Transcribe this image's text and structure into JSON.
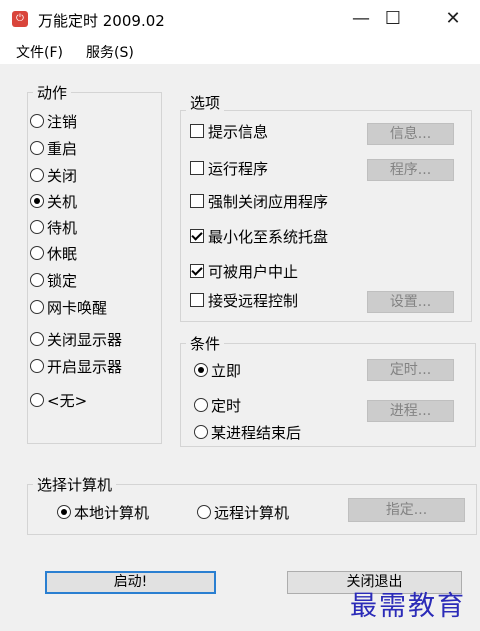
{
  "window": {
    "title": "万能定时 2009.02",
    "icon": "timer-app-icon"
  },
  "menu": [
    "文件(F)",
    "服务(S)"
  ],
  "actions": {
    "legend": "动作",
    "items": [
      {
        "label": "注销",
        "selected": false
      },
      {
        "label": "重启",
        "selected": false
      },
      {
        "label": "关闭",
        "selected": false
      },
      {
        "label": "关机",
        "selected": true
      },
      {
        "label": "待机",
        "selected": false
      },
      {
        "label": "休眠",
        "selected": false
      },
      {
        "label": "锁定",
        "selected": false
      },
      {
        "label": "网卡唤醒",
        "selected": false
      },
      {
        "label": "关闭显示器",
        "selected": false
      },
      {
        "label": "开启显示器",
        "selected": false
      },
      {
        "label": "<无>",
        "selected": false
      }
    ]
  },
  "options": {
    "legend": "选项",
    "items": [
      {
        "label": "提示信息",
        "checked": false,
        "button": "信息..."
      },
      {
        "label": "运行程序",
        "checked": false,
        "button": "程序..."
      },
      {
        "label": "强制关闭应用程序",
        "checked": false
      },
      {
        "label": "最小化至系统托盘",
        "checked": true
      },
      {
        "label": "可被用户中止",
        "checked": true
      },
      {
        "label": "接受远程控制",
        "checked": false,
        "button": "设置..."
      }
    ]
  },
  "conditions": {
    "legend": "条件",
    "items": [
      {
        "label": "立即",
        "selected": true,
        "button": "定时..."
      },
      {
        "label": "定时",
        "selected": false,
        "button": "进程..."
      },
      {
        "label": "某进程结束后",
        "selected": false
      }
    ]
  },
  "computer": {
    "legend": "选择计算机",
    "local": "本地计算机",
    "remote": "远程计算机",
    "selected": "local",
    "specify_button": "指定..."
  },
  "buttons": {
    "start": "启动!",
    "exit": "关闭退出"
  },
  "watermark": "最需教育",
  "colors": {
    "default_button_border": "#2a7fd1",
    "watermark": "#2b2bb8",
    "app_icon": "#d9453b"
  }
}
